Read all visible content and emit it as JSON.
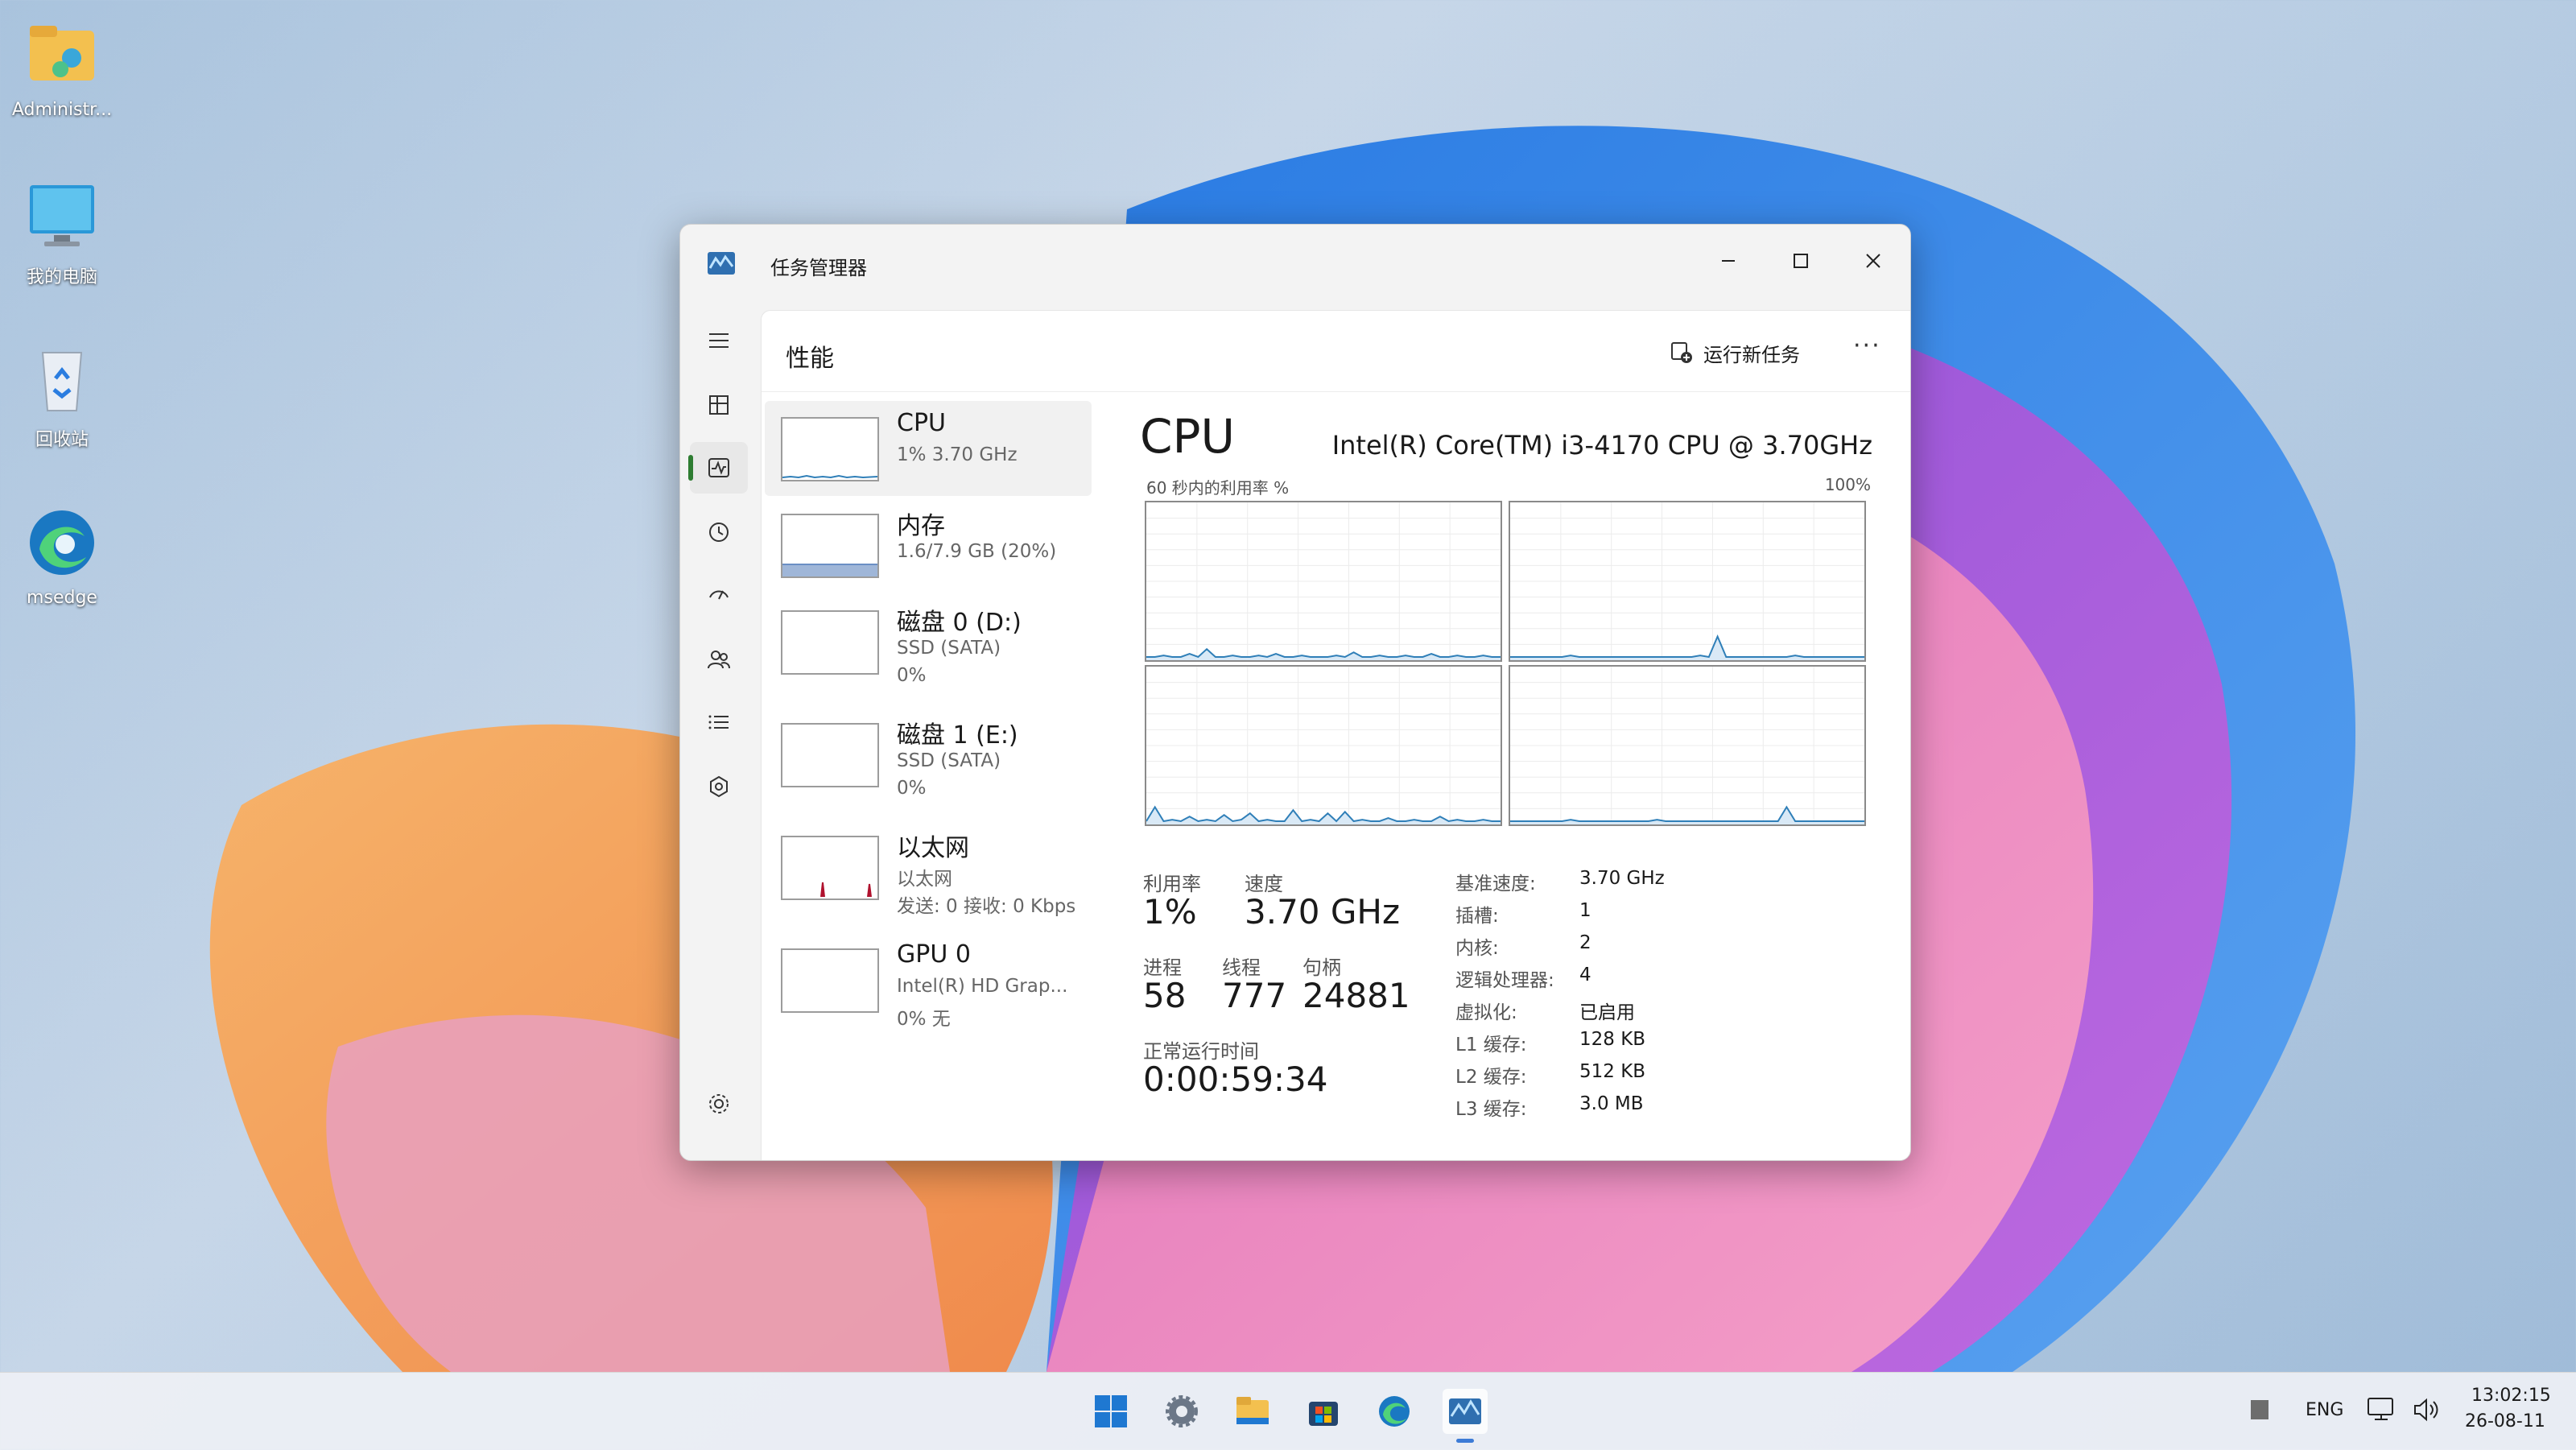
{
  "desktop": {
    "icons": [
      {
        "label": "Administr...",
        "icon": "user-folder-icon"
      },
      {
        "label": "我的电脑",
        "icon": "monitor-icon"
      },
      {
        "label": "回收站",
        "icon": "recycle-bin-icon"
      },
      {
        "label": "msedge",
        "icon": "edge-icon"
      }
    ]
  },
  "window": {
    "title": "任务管理器",
    "controls": {
      "minimize": "minimize-icon",
      "maximize": "maximize-icon",
      "close": "close-icon"
    }
  },
  "nav": {
    "items": [
      "hamburger-menu-icon",
      "processes-icon",
      "performance-icon",
      "app-history-icon",
      "startup-apps-icon",
      "users-icon",
      "details-icon",
      "services-icon"
    ],
    "active_index": 2,
    "settings": "settings-icon"
  },
  "header": {
    "title": "性能",
    "run_task_label": "运行新任务",
    "more": "···"
  },
  "devices": [
    {
      "name": "CPU",
      "line1": "1% 3.70 GHz",
      "line2": ""
    },
    {
      "name": "内存",
      "line1": "1.6/7.9 GB (20%)",
      "line2": ""
    },
    {
      "name": "磁盘 0 (D:)",
      "line1": "SSD (SATA)",
      "line2": "0%"
    },
    {
      "name": "磁盘 1 (E:)",
      "line1": "SSD (SATA)",
      "line2": "0%"
    },
    {
      "name": "以太网",
      "line1": "以太网",
      "line2": "发送: 0 接收: 0 Kbps"
    },
    {
      "name": "GPU 0",
      "line1": "Intel(R) HD Grap...",
      "line2": "0% 无"
    }
  ],
  "detail": {
    "title": "CPU",
    "model": "Intel(R) Core(TM) i3-4170 CPU @ 3.70GHz",
    "graph_label": "60 秒内的利用率 %",
    "graph_max": "100%",
    "utilization_label": "利用率",
    "utilization_value": "1%",
    "speed_label": "速度",
    "speed_value": "3.70 GHz",
    "processes_label": "进程",
    "processes_value": "58",
    "threads_label": "线程",
    "threads_value": "777",
    "handles_label": "句柄",
    "handles_value": "24881",
    "uptime_label": "正常运行时间",
    "uptime_value": "0:00:59:34",
    "specs": [
      {
        "label": "基准速度:",
        "value": "3.70 GHz"
      },
      {
        "label": "插槽:",
        "value": "1"
      },
      {
        "label": "内核:",
        "value": "2"
      },
      {
        "label": "逻辑处理器:",
        "value": "4"
      },
      {
        "label": "虚拟化:",
        "value": "已启用"
      },
      {
        "label": "L1 缓存:",
        "value": "128 KB"
      },
      {
        "label": "L2 缓存:",
        "value": "512 KB"
      },
      {
        "label": "L3 缓存:",
        "value": "3.0 MB"
      }
    ]
  },
  "taskbar": {
    "apps": [
      "start-icon",
      "settings-icon",
      "file-explorer-icon",
      "store-icon",
      "edge-icon",
      "task-manager-icon"
    ],
    "language": "ENG",
    "time": "13:02:15",
    "date": "26-08-11"
  },
  "colors": {
    "accent_graph": "#2f7fb8",
    "nav_active": "#2e7d32",
    "network_spike": "#b0122e",
    "memory_fill": "#9fb6d8"
  }
}
